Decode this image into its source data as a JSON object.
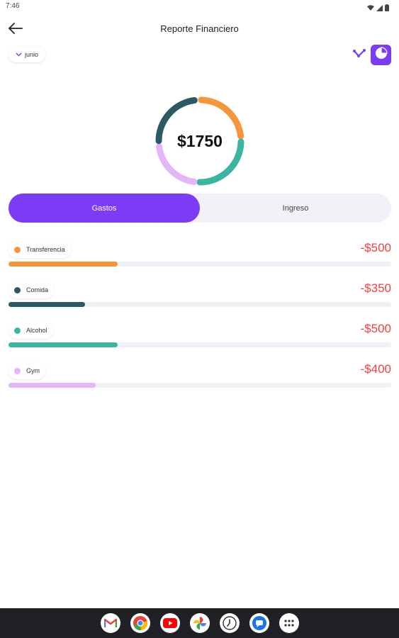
{
  "status_bar": {
    "time": "7:46"
  },
  "header": {
    "title": "Reporte Financiero"
  },
  "filter": {
    "month": "junio"
  },
  "summary": {
    "total": "$1750"
  },
  "tabs": {
    "active": "Gastos",
    "inactive": "Ingreso"
  },
  "colors": {
    "accent": "#7c3cf5",
    "negative": "#f43f3f",
    "transferencia": "#f7953a",
    "comida": "#2d5963",
    "alcohol": "#3bb5a0",
    "gym": "#e2b6f8"
  },
  "categories": [
    {
      "name": "Transferencia",
      "amount": "-$500",
      "fraction": 0.285,
      "color": "#f7953a"
    },
    {
      "name": "Comida",
      "amount": "-$350",
      "fraction": 0.2,
      "color": "#2d5963"
    },
    {
      "name": "Alcohol",
      "amount": "-$500",
      "fraction": 0.285,
      "color": "#3bb5a0"
    },
    {
      "name": "Gym",
      "amount": "-$400",
      "fraction": 0.228,
      "color": "#e2b6f8"
    }
  ],
  "dock_apps": [
    "gmail-icon",
    "chrome-icon",
    "youtube-icon",
    "photos-icon",
    "clock-app-icon",
    "messages-icon",
    "app-drawer-icon"
  ]
}
